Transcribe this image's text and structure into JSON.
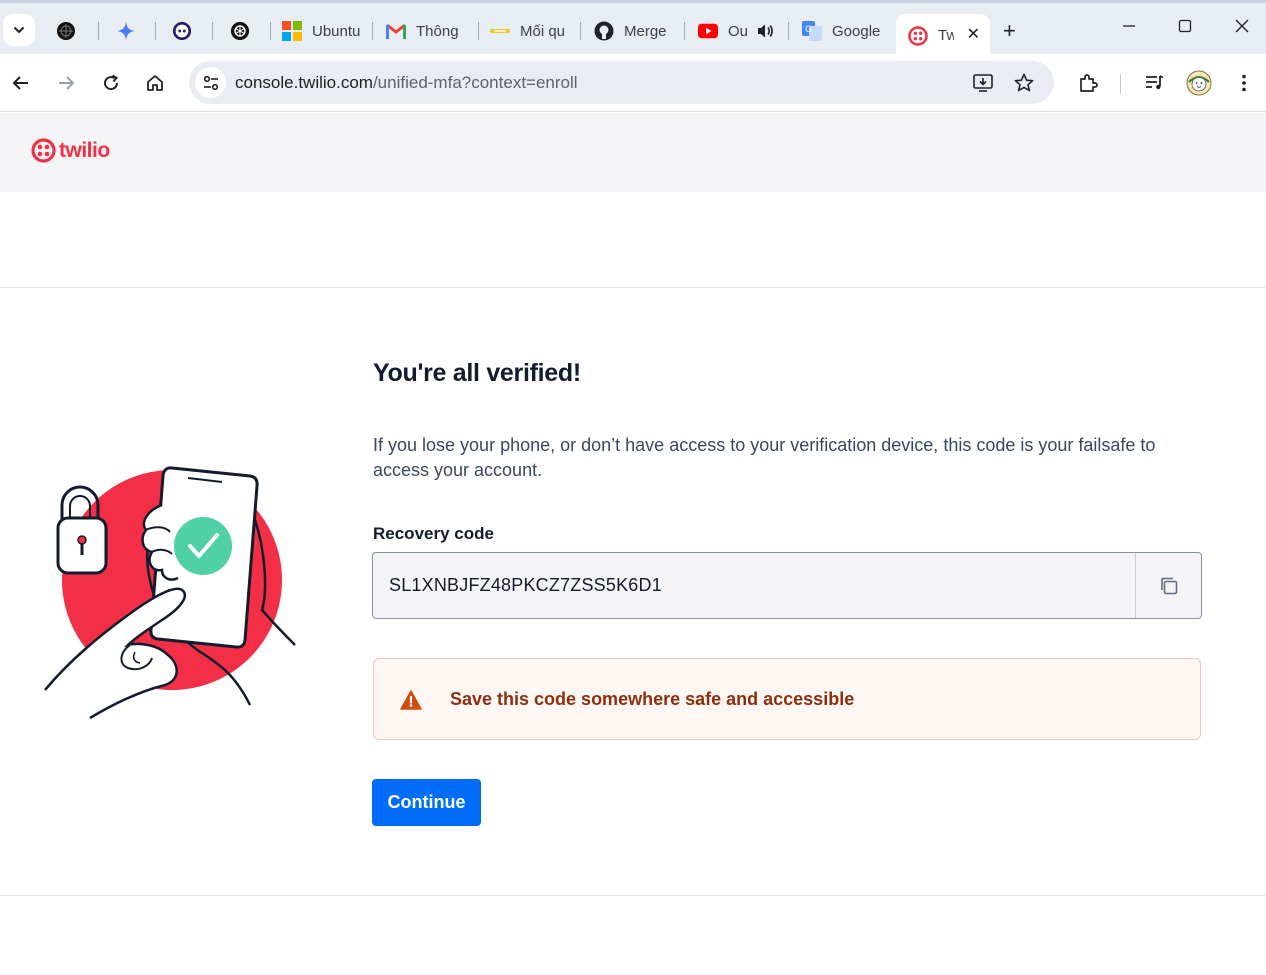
{
  "browser": {
    "tabs": [
      {
        "title": "",
        "icon": "perplexity-icon"
      },
      {
        "title": "",
        "icon": "gemini-icon"
      },
      {
        "title": "",
        "icon": "copilot-icon"
      },
      {
        "title": "",
        "icon": "chatgpt-icon"
      },
      {
        "title": "Ubuntu",
        "icon": "microsoft-icon"
      },
      {
        "title": "Thông",
        "icon": "gmail-icon"
      },
      {
        "title": "Mối qu",
        "icon": "bookmark-icon"
      },
      {
        "title": "Merge",
        "icon": "github-icon"
      },
      {
        "title": "Ou",
        "icon": "youtube-icon"
      },
      {
        "title": "Google",
        "icon": "google-translate-icon"
      },
      {
        "title": "Tw",
        "icon": "twilio-icon"
      }
    ],
    "url_host": "console.twilio.com",
    "url_path": "/unified-mfa?context=enroll"
  },
  "site": {
    "logo_text": "twilio",
    "brand_color": "#f22f46"
  },
  "main": {
    "title": "You're all verified!",
    "description": "If you lose your phone, or don’t have access to your verification device, this code is your failsafe to access your account.",
    "recovery_label": "Recovery code",
    "recovery_code": "SL1XNBJFZ48PKCZ7ZSS5K6D1",
    "warning_text": "Save this code somewhere safe and accessible",
    "continue_label": "Continue",
    "accent_color": "#006dfa",
    "warning_color": "#d14d0e",
    "success_color": "#4fd1a5"
  }
}
